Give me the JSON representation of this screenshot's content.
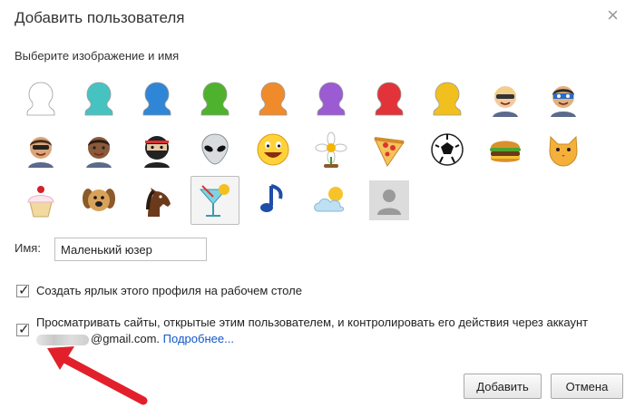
{
  "dialog": {
    "title": "Добавить пользователя",
    "close_glyph": "×",
    "subtitle": "Выберите изображение и имя"
  },
  "avatars": [
    {
      "name": "head-white",
      "color": "#ffffff"
    },
    {
      "name": "head-teal",
      "color": "#46c3c1"
    },
    {
      "name": "head-blue",
      "color": "#2f86d6"
    },
    {
      "name": "head-green",
      "color": "#4fb22e"
    },
    {
      "name": "head-orange",
      "color": "#f08b2c"
    },
    {
      "name": "head-purple",
      "color": "#9a5bd3"
    },
    {
      "name": "head-red",
      "color": "#e2333a"
    },
    {
      "name": "head-yellow",
      "color": "#f1c01e"
    },
    {
      "name": "businessman"
    },
    {
      "name": "ninja-hero"
    },
    {
      "name": "woman-sunglasses"
    },
    {
      "name": "man"
    },
    {
      "name": "ninja"
    },
    {
      "name": "alien"
    },
    {
      "name": "smiley"
    },
    {
      "name": "flower"
    },
    {
      "name": "pizza"
    },
    {
      "name": "soccer-ball"
    },
    {
      "name": "burger"
    },
    {
      "name": "cat"
    },
    {
      "name": "cupcake"
    },
    {
      "name": "dog"
    },
    {
      "name": "horse"
    },
    {
      "name": "cocktail",
      "selected": true
    },
    {
      "name": "music-note"
    },
    {
      "name": "sun-cloud"
    },
    {
      "name": "placeholder"
    }
  ],
  "name_field": {
    "label": "Имя:",
    "value": "Маленький юзер"
  },
  "options": {
    "shortcut": {
      "checked": true,
      "label": "Создать ярлык этого профиля на рабочем столе"
    },
    "supervise": {
      "checked": true,
      "label_line1": "Просматривать сайты, открытые этим пользователем, и контролировать его действия через аккаунт",
      "email_suffix": "@gmail.com.",
      "more_link": "Подробнее..."
    }
  },
  "buttons": {
    "add": "Добавить",
    "cancel": "Отмена"
  },
  "colors": {
    "link": "#1155cc",
    "annotation_arrow": "#e2202b"
  }
}
